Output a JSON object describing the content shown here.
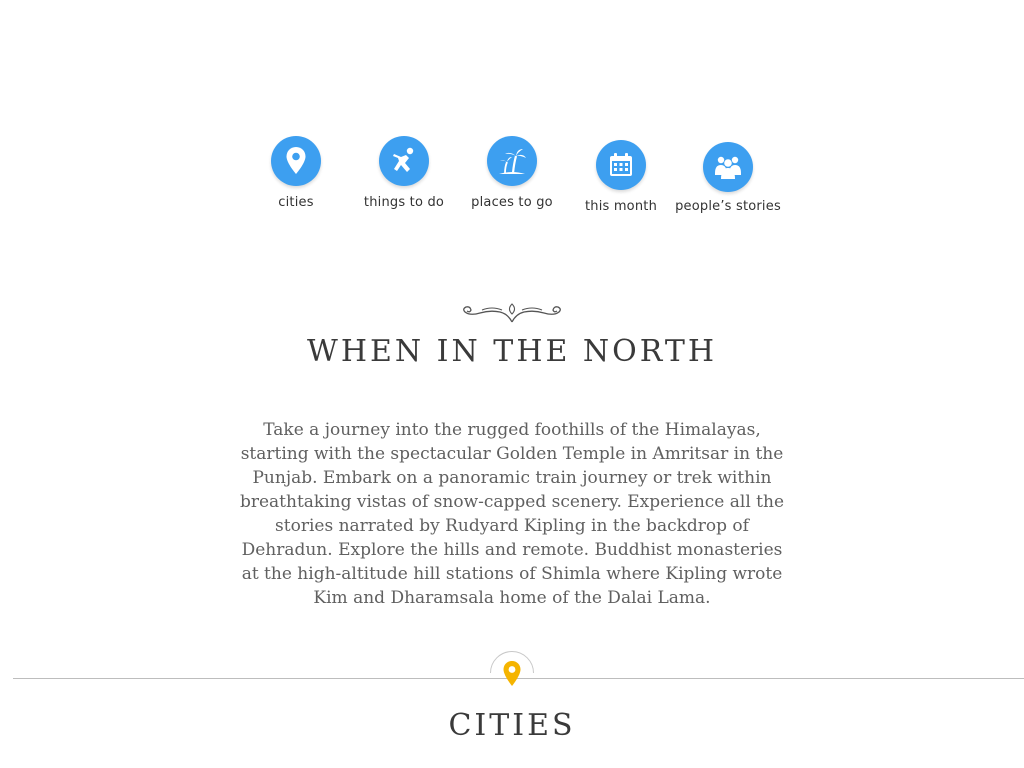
{
  "nav": {
    "items": [
      {
        "label": "cities",
        "icon": "location-pin-icon"
      },
      {
        "label": "things to do",
        "icon": "running-person-icon"
      },
      {
        "label": "places to go",
        "icon": "palm-trees-icon"
      },
      {
        "label": "this month",
        "icon": "calendar-icon"
      },
      {
        "label": "people’s stories",
        "icon": "people-group-icon"
      }
    ],
    "icon_color": "#3d9ff0"
  },
  "section": {
    "title": "WHEN IN THE NORTH",
    "description": "Take a journey into the rugged foothills of the Himalayas, starting with the spectacular Golden Temple in Amritsar in the Punjab. Embark on a panoramic train journey or trek within breathtaking vistas of snow-capped scenery.  Experience all the stories narrated by Rudyard Kipling in the backdrop of Dehradun. Explore the hills and remote. Buddhist monasteries at the high-altitude hill stations of Shimla where Kipling wrote Kim and Dharamsala home of the Dalai Lama."
  },
  "cities": {
    "title": "CITIES",
    "icon": "location-pin-icon",
    "pin_color": "#f5b400"
  }
}
